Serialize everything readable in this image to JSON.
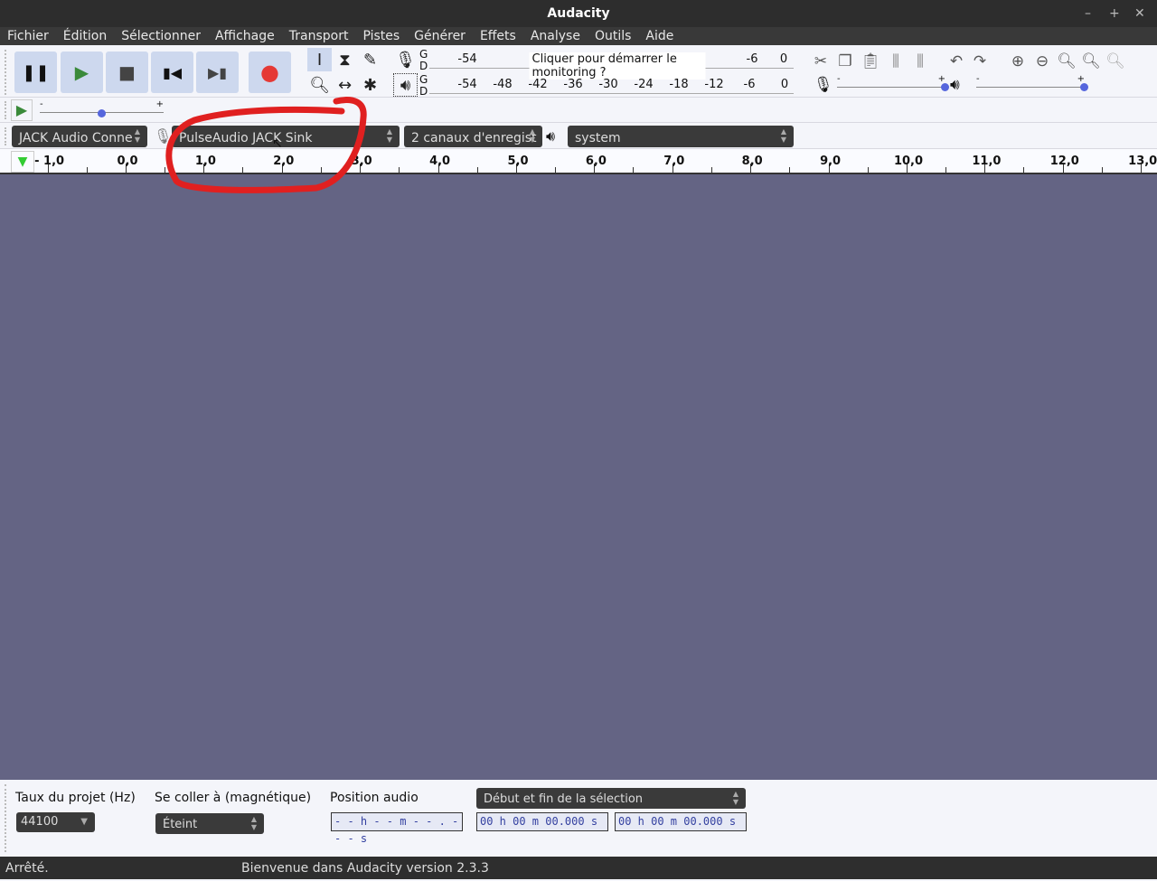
{
  "window": {
    "title": "Audacity"
  },
  "menu": [
    "Fichier",
    "Édition",
    "Sélectionner",
    "Affichage",
    "Transport",
    "Pistes",
    "Générer",
    "Effets",
    "Analyse",
    "Outils",
    "Aide"
  ],
  "meter": {
    "rec_channels": "G",
    "rec_channels2": "D",
    "play_channels": "G",
    "play_channels2": "D",
    "monitor_prompt": "Cliquer pour démarrer le monitoring ?",
    "rec_labels": [
      "-54",
      "-6",
      "0"
    ],
    "play_labels": [
      "-54",
      "-48",
      "-42",
      "-36",
      "-30",
      "-24",
      "-18",
      "-12",
      "-6",
      "0"
    ]
  },
  "devices": {
    "host": "JACK Audio Conne",
    "recording": "PulseAudio JACK Sink",
    "channels": "2 canaux d'enregist",
    "playback": "system"
  },
  "speed_slider": {
    "min": "-",
    "max": "+",
    "value": 0.5
  },
  "volume": {
    "rec_min": "-",
    "rec_max": "+",
    "rec_value": 1.0,
    "play_min": "-",
    "play_max": "+",
    "play_value": 1.0
  },
  "ruler": {
    "labels": [
      "- 1,0",
      "0,0",
      "1,0",
      "2,0",
      "3,0",
      "4,0",
      "5,0",
      "6,0",
      "7,0",
      "8,0",
      "9,0",
      "10,0",
      "11,0",
      "12,0",
      "13,0"
    ],
    "values": [
      -1,
      0,
      1,
      2,
      3,
      4,
      5,
      6,
      7,
      8,
      9,
      10,
      11,
      12,
      13
    ]
  },
  "selection": {
    "rate_label": "Taux du projet (Hz)",
    "rate": "44100",
    "snap_label": "Se coller à (magnétique)",
    "snap": "Éteint",
    "position_label": "Position audio",
    "position": "- - h - - m - - . - - - s",
    "sel_mode": "Début et fin de la sélection",
    "start": "00 h 00 m 00.000 s",
    "end": "00 h 00 m 00.000 s"
  },
  "status": {
    "state": "Arrêté.",
    "message": "Bienvenue dans Audacity version 2.3.3"
  },
  "colors": {
    "track_bg": "#646484",
    "button": "#cdd8ee",
    "record": "#e53935",
    "annotation": "#e02020"
  }
}
